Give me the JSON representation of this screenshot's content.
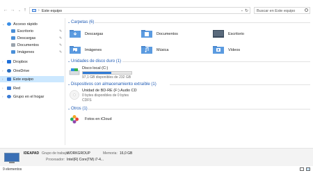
{
  "address_bar": {
    "location": "Este equipo",
    "separator": "›"
  },
  "search": {
    "placeholder": "Buscar en Este equipo"
  },
  "nav": {
    "back": "←",
    "forward": "→",
    "recent": "⌄",
    "up": "↑",
    "dropdown": "⌄",
    "refresh": "↻"
  },
  "sidebar": {
    "items": [
      {
        "label": "Acceso rápido",
        "icon": "star-icon",
        "color": "#3a8ee6",
        "expanded": true
      },
      {
        "label": "Escritorio",
        "icon": "desktop-folder-icon",
        "color": "#4a8fd8",
        "pinned": true
      },
      {
        "label": "Descargas",
        "icon": "downloads-folder-icon",
        "color": "#4a8fd8",
        "pinned": true
      },
      {
        "label": "Documentos",
        "icon": "documents-folder-icon",
        "color": "#9aa3ad",
        "pinned": true
      },
      {
        "label": "Imágenes",
        "icon": "pictures-folder-icon",
        "color": "#4a8fd8",
        "pinned": true
      },
      {
        "label": "Dropbox",
        "icon": "dropbox-icon",
        "color": "#1e6fd9"
      },
      {
        "label": "OneDrive",
        "icon": "onedrive-icon",
        "color": "#2a6ebf"
      },
      {
        "label": "Este equipo",
        "icon": "computer-icon",
        "color": "#3a7bd5",
        "selected": true
      },
      {
        "label": "Red",
        "icon": "network-icon",
        "color": "#3a7bd5"
      },
      {
        "label": "Grupo en el hogar",
        "icon": "homegroup-icon",
        "color": "#3a7bd5"
      }
    ],
    "pin_glyph": "✎"
  },
  "groups": {
    "folders": {
      "title": "Carpetas (6)"
    },
    "drives": {
      "title": "Unidades de disco duro (1)"
    },
    "removable": {
      "title": "Dispositivos con almacenamiento extraíble (1)"
    },
    "others": {
      "title": "Otros (1)"
    }
  },
  "folders": [
    {
      "label": "Descargas",
      "icon": "downloads-folder-icon"
    },
    {
      "label": "Documentos",
      "icon": "documents-folder-icon"
    },
    {
      "label": "Escritorio",
      "icon": "desktop-folder-icon"
    },
    {
      "label": "Imágenes",
      "icon": "pictures-folder-icon"
    },
    {
      "label": "Música",
      "icon": "music-folder-icon"
    },
    {
      "label": "Vídeos",
      "icon": "videos-folder-icon"
    }
  ],
  "drives": [
    {
      "label": "Disco local (C:)",
      "free": "97,1 GB disponibles de 232 GB",
      "used_fraction": 0.58,
      "bar_color": "#2f7ad6"
    }
  ],
  "removable": [
    {
      "label": "Unidad de BD-RE (F:) Audio CD",
      "free": "0 bytes disponibles de 0 bytes",
      "fs": "CDFS"
    }
  ],
  "others": [
    {
      "label": "Fotos en iCloud",
      "icon": "icloud-photos-icon"
    }
  ],
  "details": {
    "computer_name": "IDEAPAD",
    "workgroup_label": "Grupo de trabajo:",
    "workgroup_value": "WORKGROUP",
    "memory_label": "Memoria:",
    "memory_value": "16,0 GB",
    "processor_label": "Procesador:",
    "processor_value": "Intel(R) Core(TM) i7-4..."
  },
  "status": {
    "items_count": "9 elementos"
  },
  "colors": {
    "accent": "#1e5ab4",
    "selection": "#cce8ff",
    "folder_blue": "#4a8fd8"
  }
}
